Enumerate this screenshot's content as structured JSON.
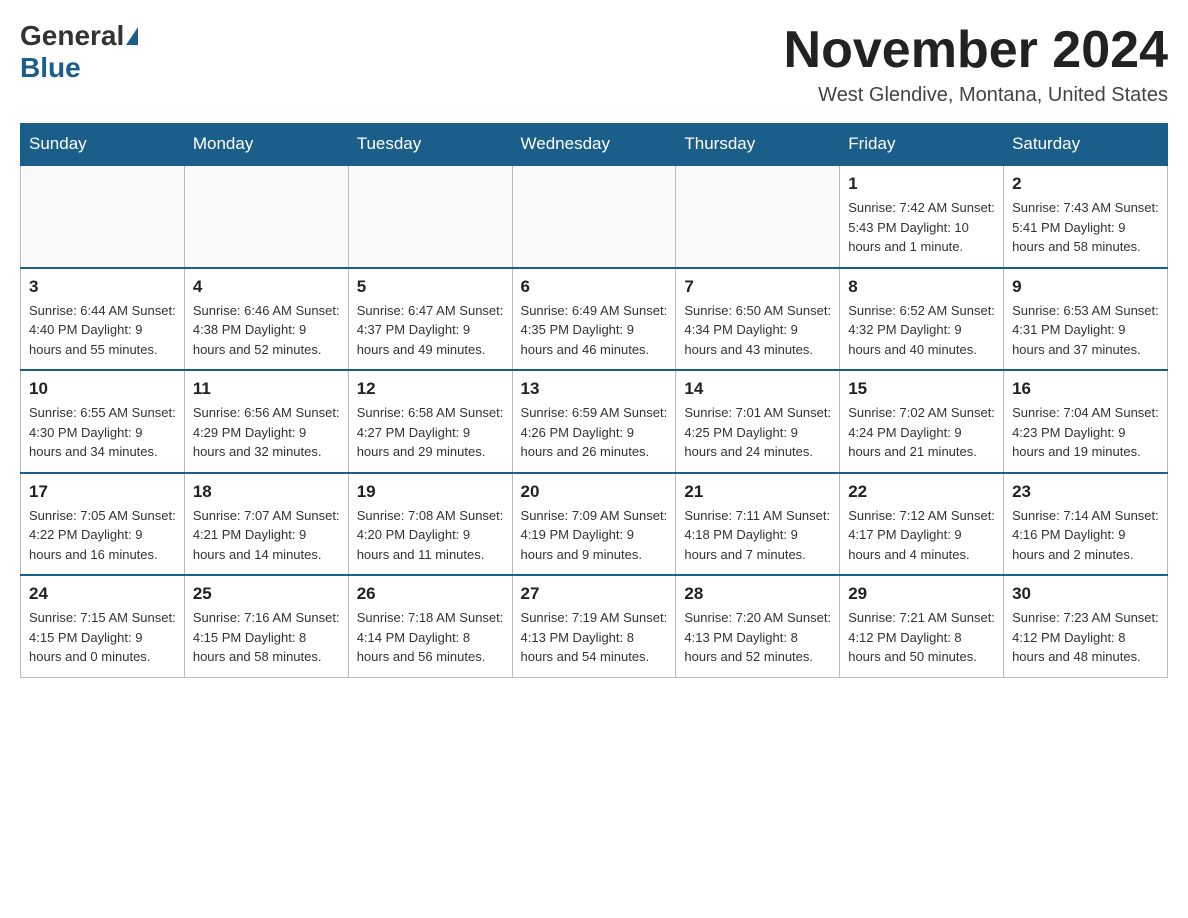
{
  "header": {
    "logo_general": "General",
    "logo_blue": "Blue",
    "month_title": "November 2024",
    "location": "West Glendive, Montana, United States"
  },
  "days_of_week": [
    "Sunday",
    "Monday",
    "Tuesday",
    "Wednesday",
    "Thursday",
    "Friday",
    "Saturday"
  ],
  "weeks": [
    [
      {
        "day": "",
        "info": ""
      },
      {
        "day": "",
        "info": ""
      },
      {
        "day": "",
        "info": ""
      },
      {
        "day": "",
        "info": ""
      },
      {
        "day": "",
        "info": ""
      },
      {
        "day": "1",
        "info": "Sunrise: 7:42 AM\nSunset: 5:43 PM\nDaylight: 10 hours and 1 minute."
      },
      {
        "day": "2",
        "info": "Sunrise: 7:43 AM\nSunset: 5:41 PM\nDaylight: 9 hours and 58 minutes."
      }
    ],
    [
      {
        "day": "3",
        "info": "Sunrise: 6:44 AM\nSunset: 4:40 PM\nDaylight: 9 hours and 55 minutes."
      },
      {
        "day": "4",
        "info": "Sunrise: 6:46 AM\nSunset: 4:38 PM\nDaylight: 9 hours and 52 minutes."
      },
      {
        "day": "5",
        "info": "Sunrise: 6:47 AM\nSunset: 4:37 PM\nDaylight: 9 hours and 49 minutes."
      },
      {
        "day": "6",
        "info": "Sunrise: 6:49 AM\nSunset: 4:35 PM\nDaylight: 9 hours and 46 minutes."
      },
      {
        "day": "7",
        "info": "Sunrise: 6:50 AM\nSunset: 4:34 PM\nDaylight: 9 hours and 43 minutes."
      },
      {
        "day": "8",
        "info": "Sunrise: 6:52 AM\nSunset: 4:32 PM\nDaylight: 9 hours and 40 minutes."
      },
      {
        "day": "9",
        "info": "Sunrise: 6:53 AM\nSunset: 4:31 PM\nDaylight: 9 hours and 37 minutes."
      }
    ],
    [
      {
        "day": "10",
        "info": "Sunrise: 6:55 AM\nSunset: 4:30 PM\nDaylight: 9 hours and 34 minutes."
      },
      {
        "day": "11",
        "info": "Sunrise: 6:56 AM\nSunset: 4:29 PM\nDaylight: 9 hours and 32 minutes."
      },
      {
        "day": "12",
        "info": "Sunrise: 6:58 AM\nSunset: 4:27 PM\nDaylight: 9 hours and 29 minutes."
      },
      {
        "day": "13",
        "info": "Sunrise: 6:59 AM\nSunset: 4:26 PM\nDaylight: 9 hours and 26 minutes."
      },
      {
        "day": "14",
        "info": "Sunrise: 7:01 AM\nSunset: 4:25 PM\nDaylight: 9 hours and 24 minutes."
      },
      {
        "day": "15",
        "info": "Sunrise: 7:02 AM\nSunset: 4:24 PM\nDaylight: 9 hours and 21 minutes."
      },
      {
        "day": "16",
        "info": "Sunrise: 7:04 AM\nSunset: 4:23 PM\nDaylight: 9 hours and 19 minutes."
      }
    ],
    [
      {
        "day": "17",
        "info": "Sunrise: 7:05 AM\nSunset: 4:22 PM\nDaylight: 9 hours and 16 minutes."
      },
      {
        "day": "18",
        "info": "Sunrise: 7:07 AM\nSunset: 4:21 PM\nDaylight: 9 hours and 14 minutes."
      },
      {
        "day": "19",
        "info": "Sunrise: 7:08 AM\nSunset: 4:20 PM\nDaylight: 9 hours and 11 minutes."
      },
      {
        "day": "20",
        "info": "Sunrise: 7:09 AM\nSunset: 4:19 PM\nDaylight: 9 hours and 9 minutes."
      },
      {
        "day": "21",
        "info": "Sunrise: 7:11 AM\nSunset: 4:18 PM\nDaylight: 9 hours and 7 minutes."
      },
      {
        "day": "22",
        "info": "Sunrise: 7:12 AM\nSunset: 4:17 PM\nDaylight: 9 hours and 4 minutes."
      },
      {
        "day": "23",
        "info": "Sunrise: 7:14 AM\nSunset: 4:16 PM\nDaylight: 9 hours and 2 minutes."
      }
    ],
    [
      {
        "day": "24",
        "info": "Sunrise: 7:15 AM\nSunset: 4:15 PM\nDaylight: 9 hours and 0 minutes."
      },
      {
        "day": "25",
        "info": "Sunrise: 7:16 AM\nSunset: 4:15 PM\nDaylight: 8 hours and 58 minutes."
      },
      {
        "day": "26",
        "info": "Sunrise: 7:18 AM\nSunset: 4:14 PM\nDaylight: 8 hours and 56 minutes."
      },
      {
        "day": "27",
        "info": "Sunrise: 7:19 AM\nSunset: 4:13 PM\nDaylight: 8 hours and 54 minutes."
      },
      {
        "day": "28",
        "info": "Sunrise: 7:20 AM\nSunset: 4:13 PM\nDaylight: 8 hours and 52 minutes."
      },
      {
        "day": "29",
        "info": "Sunrise: 7:21 AM\nSunset: 4:12 PM\nDaylight: 8 hours and 50 minutes."
      },
      {
        "day": "30",
        "info": "Sunrise: 7:23 AM\nSunset: 4:12 PM\nDaylight: 8 hours and 48 minutes."
      }
    ]
  ]
}
